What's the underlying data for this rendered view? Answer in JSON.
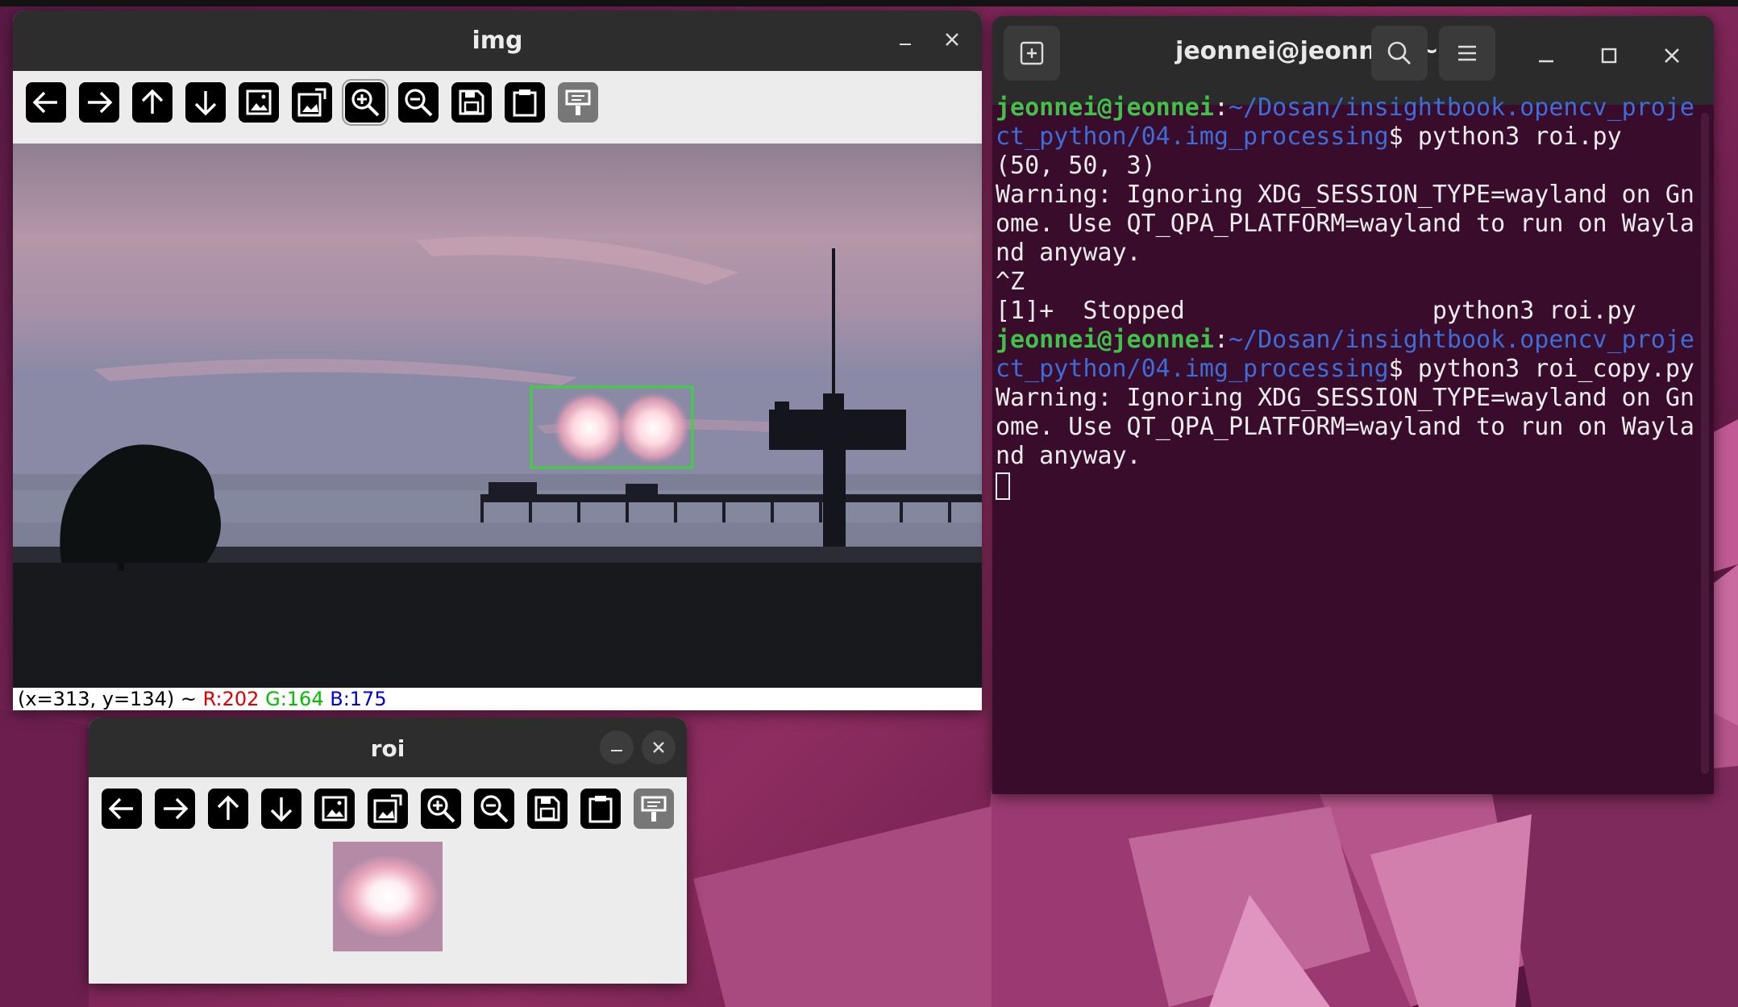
{
  "img_window": {
    "title": "img",
    "status": {
      "coords": "(x=313, y=134) ~",
      "r": "R:202",
      "g": "G:164",
      "b": "B:175"
    }
  },
  "roi_window": {
    "title": "roi"
  },
  "toolbar_icons": [
    "arrow-left-icon",
    "arrow-right-icon",
    "arrow-up-icon",
    "arrow-down-icon",
    "image-icon",
    "image-edit-icon",
    "zoom-in-icon",
    "zoom-out-icon",
    "save-icon",
    "clipboard-icon",
    "properties-icon"
  ],
  "terminal": {
    "title": "jeonnei@jeonnei: ~/...",
    "lines": {
      "p1_user": "jeonnei@jeonnei",
      "p1_colon": ":",
      "p1_path": "~/Dosan/insightbook.opencv_project_python/04.img_processing",
      "p1_cmd": "$ python3 roi.py",
      "l2": "(50, 50, 3)",
      "l3": "Warning: Ignoring XDG_SESSION_TYPE=wayland on Gnome. Use QT_QPA_PLATFORM=wayland to run on Wayland anyway.",
      "l4": "^Z",
      "l5": "[1]+  Stopped                 python3 roi.py",
      "p2_user": "jeonnei@jeonnei",
      "p2_colon": ":",
      "p2_path": "~/Dosan/insightbook.opencv_project_python/04.img_processing",
      "p2_cmd": "$ python3 roi_copy.py",
      "l7": "Warning: Ignoring XDG_SESSION_TYPE=wayland on Gnome. Use QT_QPA_PLATFORM=wayland to run on Wayland anyway."
    }
  },
  "colors": {
    "terminal_bg": "#380c2a",
    "prompt_user": "#3ec24a",
    "prompt_path": "#3e6dd8",
    "roi_rect": "#3fd13f"
  }
}
